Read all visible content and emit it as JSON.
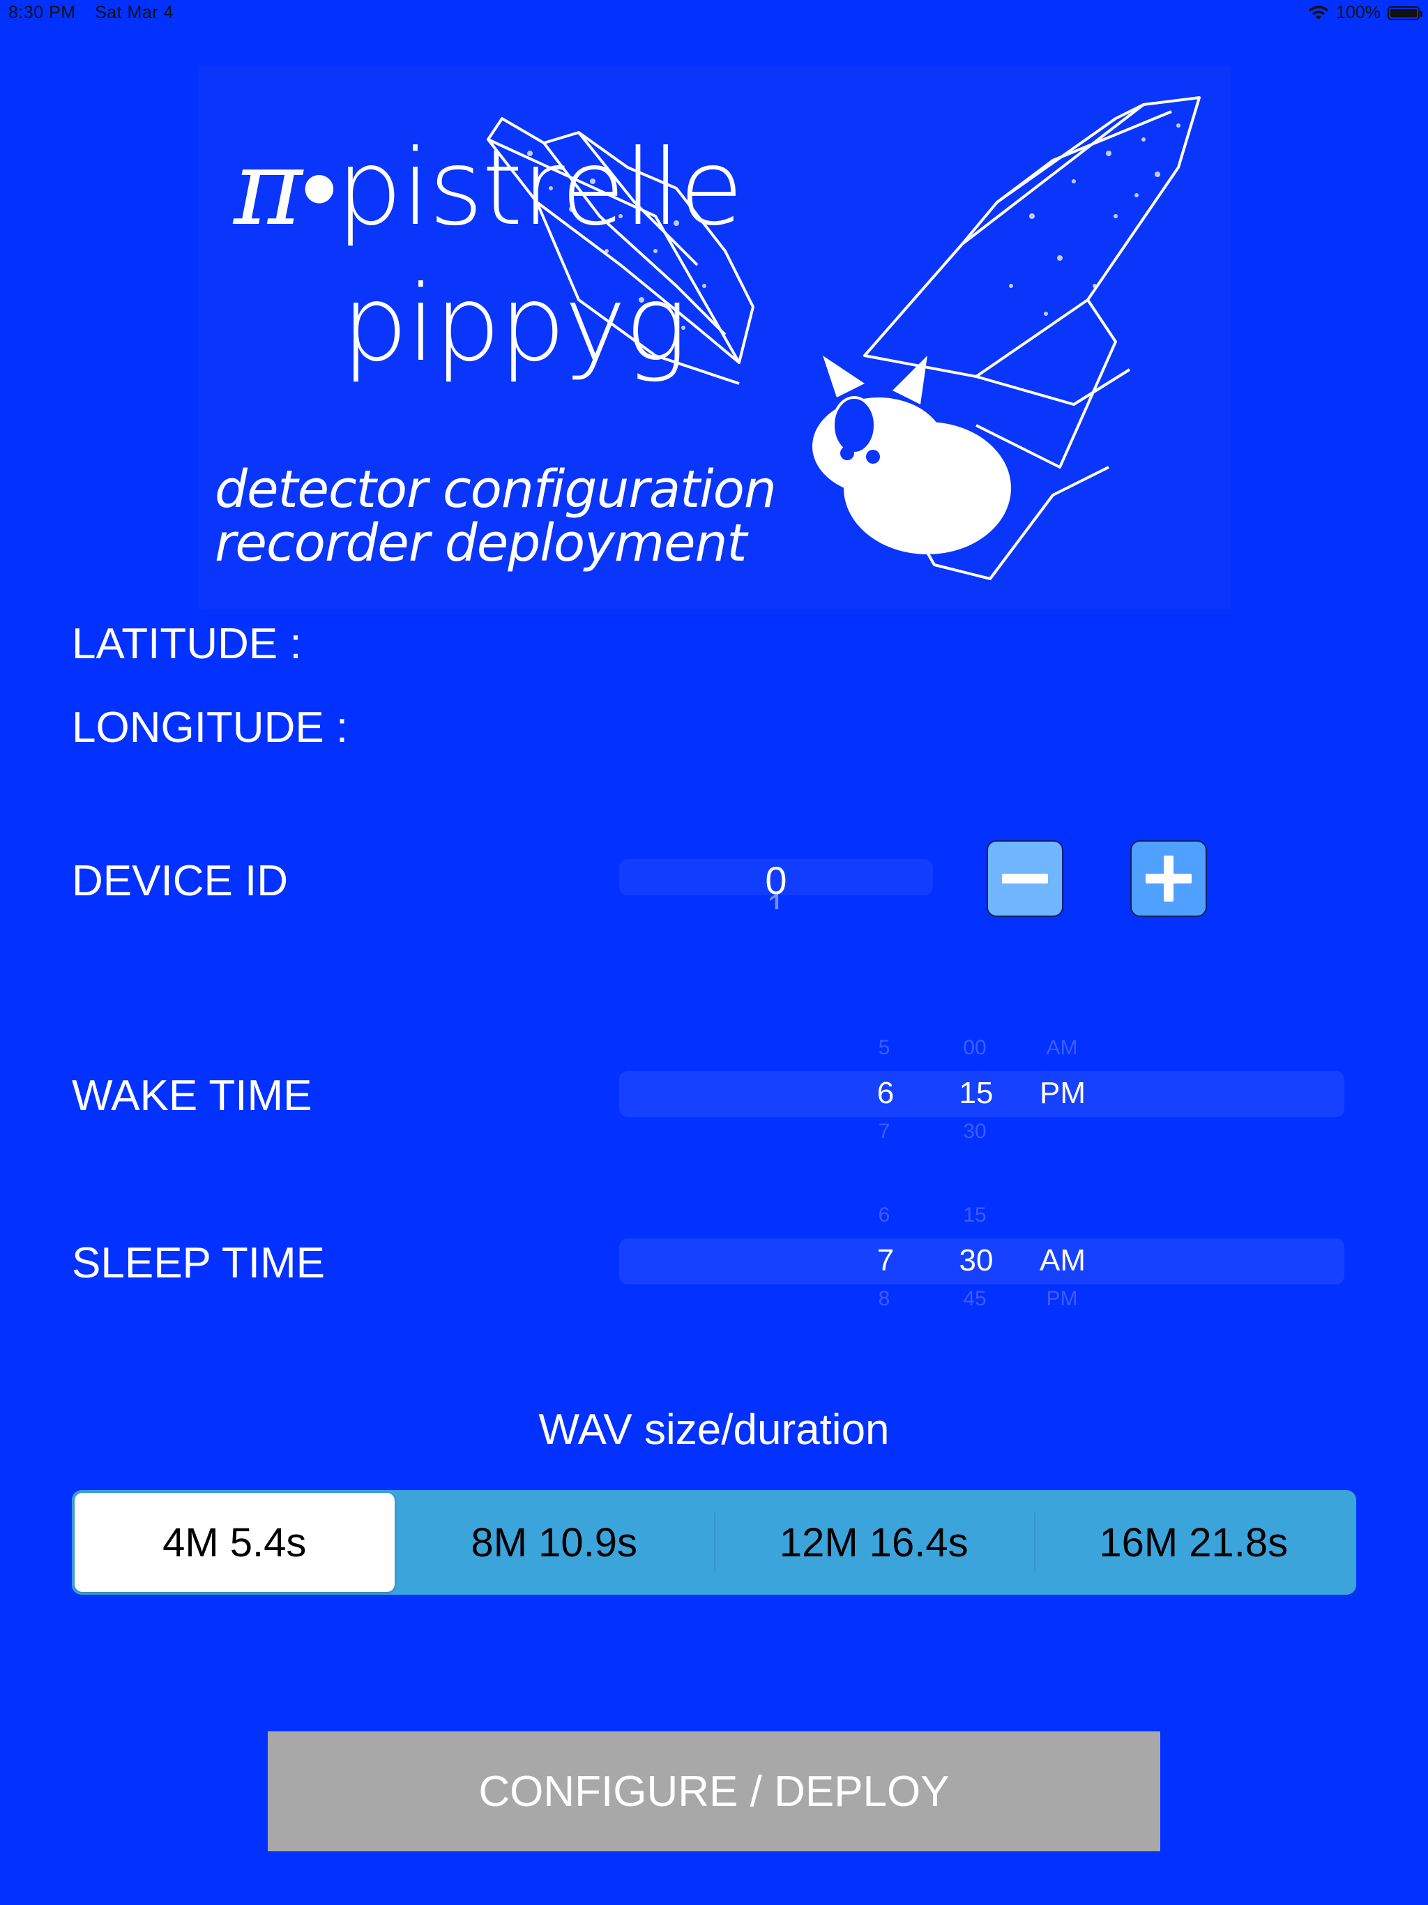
{
  "status_bar": {
    "time": "8:30 PM",
    "date": "Sat Mar 4",
    "battery": "100%",
    "battery_level": 1.0
  },
  "header": {
    "title_pi": "π",
    "title_rest": "•pistrelle",
    "title_line2": "pippyg",
    "subtitle_1": "detector configuration",
    "subtitle_2": "recorder deployment",
    "bat_image": "bat-icon"
  },
  "location": {
    "latitude_label": "LATITUDE  :",
    "longitude_label": "LONGITUDE  :"
  },
  "device": {
    "label": "DEVICE  ID",
    "value": "0",
    "next_value": "1"
  },
  "wake_time": {
    "label": "WAKE TIME",
    "hour_prev": "5",
    "hour": "6",
    "hour_next": "7",
    "minute_prev": "00",
    "minute": "15",
    "minute_next": "30",
    "ampm_prev": "AM",
    "ampm": "PM"
  },
  "sleep_time": {
    "label": "SLEEP TIME",
    "hour_prev": "6",
    "hour": "7",
    "hour_next": "8",
    "minute_prev": "15",
    "minute": "30",
    "minute_next": "45",
    "ampm": "AM",
    "ampm_next": "PM"
  },
  "wav": {
    "label": "WAV size/duration",
    "options": [
      "4M 5.4s",
      "8M 10.9s",
      "12M 16.4s",
      "16M 21.8s"
    ],
    "selected": "4M 5.4s"
  },
  "deploy_button": {
    "label": "CONFIGURE / DEPLOY"
  },
  "colors": {
    "background": "#0331ff",
    "segment_bg": "#3ba4db",
    "stepper": "#70b6ff",
    "deploy_disabled": "#a8a8a8"
  }
}
